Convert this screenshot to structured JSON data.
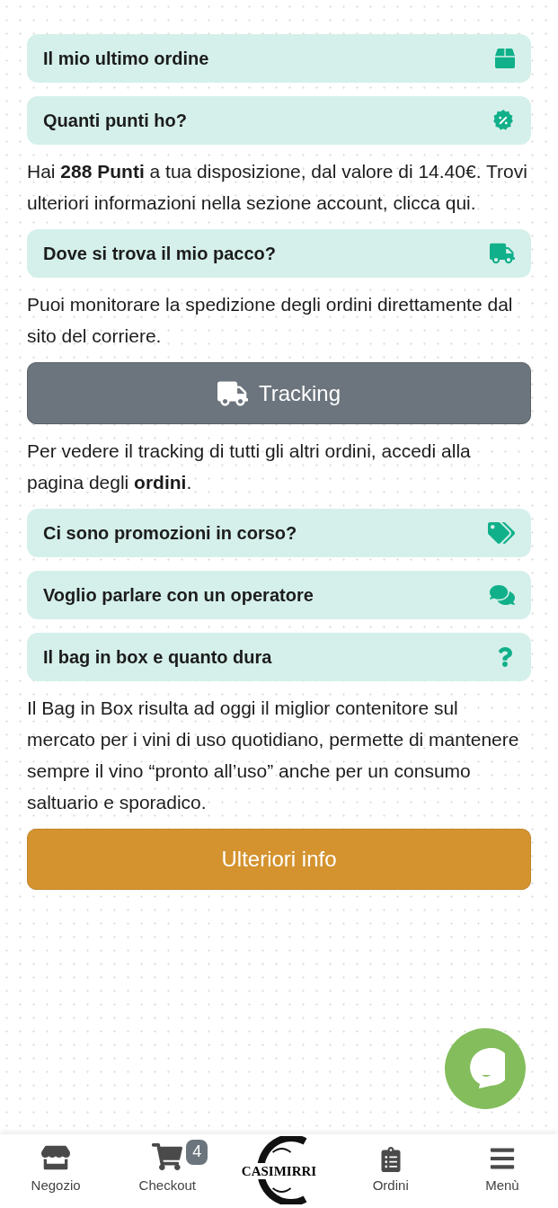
{
  "faq": [
    {
      "kind": "question",
      "label": "Il mio ultimo ordine"
    },
    {
      "kind": "question",
      "label": "Quanti punti ho?"
    },
    {
      "kind": "text",
      "text": "Hai **288 Punti** a tua disposizione, dal valore di 14.40€. Trovi ulteriori informazioni nella sezione account, clicca qui."
    },
    {
      "kind": "question",
      "label": "Dove si trova il mio pacco?"
    },
    {
      "kind": "text",
      "text": "Puoi monitorare la spedizione degli ordini direttamente dal sito del corriere."
    },
    {
      "kind": "tracking_button",
      "label": "Tracking"
    },
    {
      "kind": "text",
      "text": "Per vedere il tracking di tutti gli altri ordini, accedi alla pagina degli **ordini**."
    },
    {
      "kind": "question",
      "label": "Ci sono promozioni in corso?"
    },
    {
      "kind": "question",
      "label": "Voglio parlare con un operatore"
    },
    {
      "kind": "question",
      "label": "Il bag in box e quanto dura"
    },
    {
      "kind": "text",
      "text": "Il Bag in Box risulta ad oggi il miglior contenitore sul mercato per i vini di uso quotidiano, permette di mantenere sempre il vino “pronto all’uso” anche per un consumo saltuario e sporadico."
    },
    {
      "kind": "info_button",
      "label": "Ulteriori info"
    }
  ],
  "bottom_nav": [
    {
      "kind": "tab",
      "label": "Negozio"
    },
    {
      "kind": "tab",
      "label": "Checkout",
      "badge": "4"
    },
    {
      "kind": "logo",
      "name": "CASIMIRRI"
    },
    {
      "kind": "tab",
      "label": "Ordini"
    },
    {
      "kind": "tab",
      "label": "Menù"
    }
  ]
}
